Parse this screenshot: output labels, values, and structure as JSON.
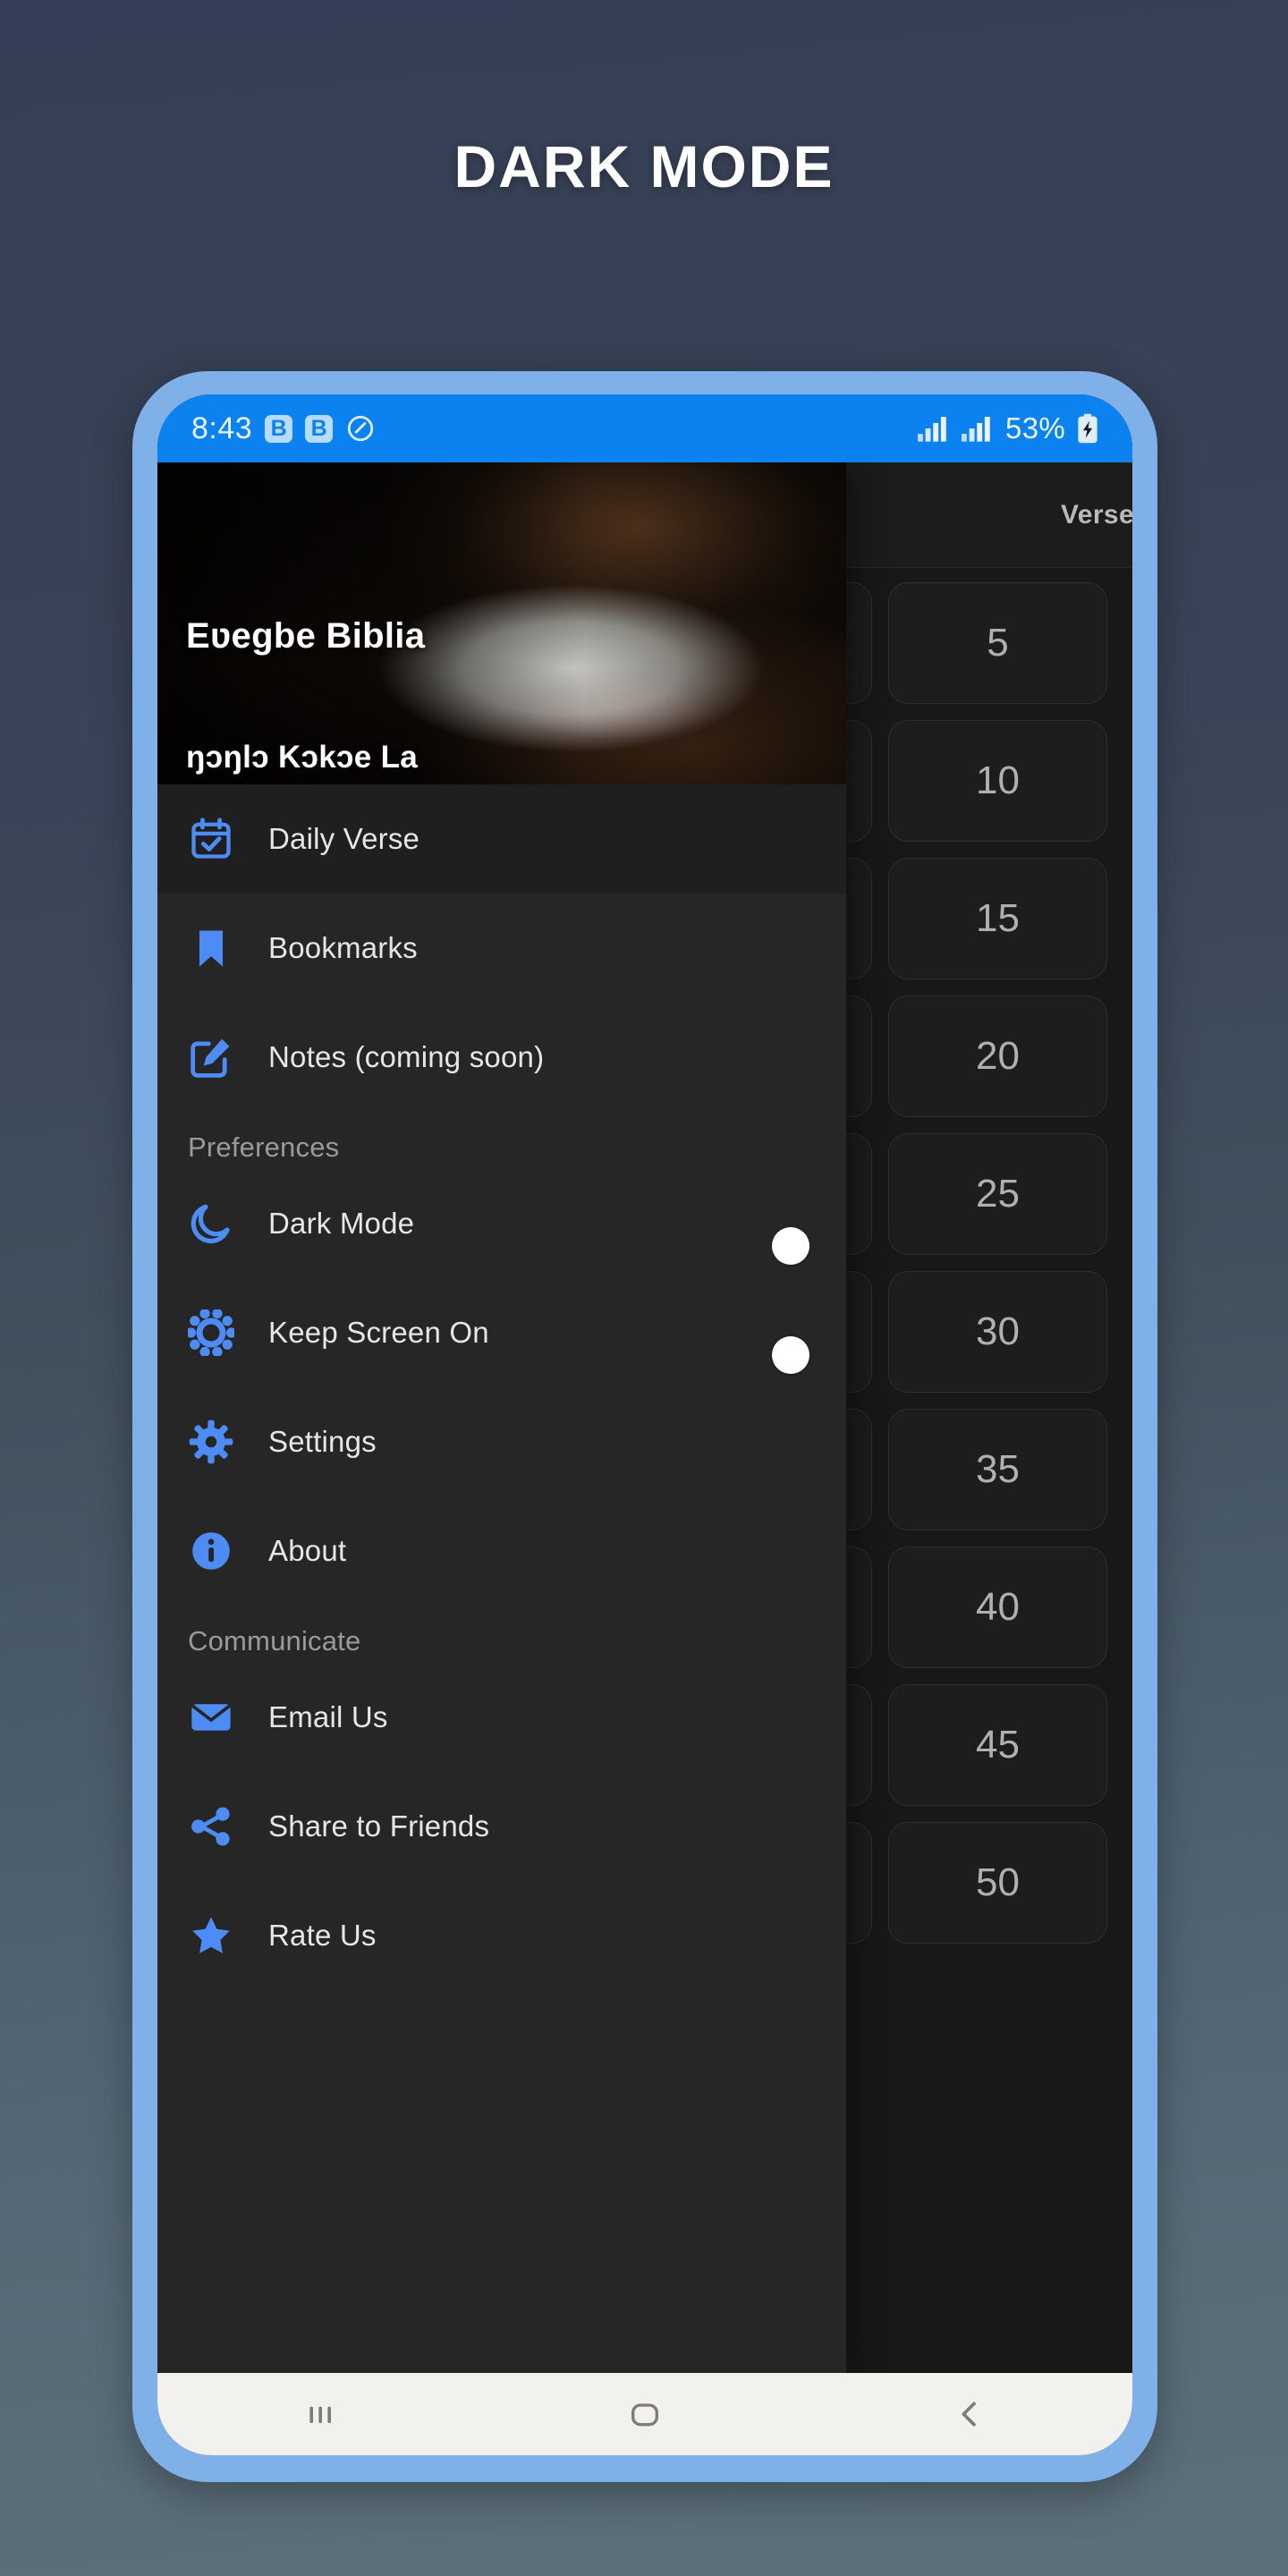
{
  "page": {
    "title": "DARK MODE"
  },
  "colors": {
    "accent": "#0d8bf2",
    "icon_blue": "#4e8cf5",
    "status_bar": "#0b82f0",
    "drawer_bg": "#262626",
    "frame": "#7fb0e8"
  },
  "status_bar": {
    "time": "8:43",
    "badge_1": "B",
    "badge_2": "B",
    "dnd_icon": "do-not-disturb-icon",
    "signal_1_icon": "signal-bars-icon",
    "signal_2_icon": "signal-bars-icon",
    "battery_percent": "53%",
    "battery_icon": "battery-charging-icon"
  },
  "drawer": {
    "title": "Eʋegbe Biblia",
    "subtitle": "ŋɔŋlɔ Kɔkɔe La",
    "items": [
      {
        "label": "Daily Verse",
        "icon": "calendar-check-icon",
        "selected": true,
        "toggle": null
      },
      {
        "label": "Bookmarks",
        "icon": "bookmark-icon",
        "selected": false,
        "toggle": null
      },
      {
        "label": "Notes (coming soon)",
        "icon": "note-edit-icon",
        "selected": false,
        "toggle": null
      }
    ],
    "sections": [
      {
        "heading": "Preferences",
        "items": [
          {
            "label": "Dark Mode",
            "icon": "moon-icon",
            "toggle": "on"
          },
          {
            "label": "Keep Screen On",
            "icon": "brightness-icon",
            "toggle": "on"
          },
          {
            "label": "Settings",
            "icon": "gear-icon",
            "toggle": null
          },
          {
            "label": "About",
            "icon": "info-icon",
            "toggle": null
          }
        ]
      },
      {
        "heading": "Communicate",
        "items": [
          {
            "label": "Email Us",
            "icon": "envelope-icon",
            "toggle": null
          },
          {
            "label": "Share to Friends",
            "icon": "share-icon",
            "toggle": null
          },
          {
            "label": "Rate Us",
            "icon": "star-icon",
            "toggle": null
          }
        ]
      }
    ]
  },
  "verse_panel": {
    "header_label": "Verse",
    "numbers": [
      "5",
      "10",
      "15",
      "20",
      "25",
      "30",
      "35",
      "40",
      "45",
      "50"
    ]
  },
  "nav_bar": {
    "recents_icon": "recents-icon",
    "home_icon": "home-icon",
    "back_icon": "back-icon"
  }
}
